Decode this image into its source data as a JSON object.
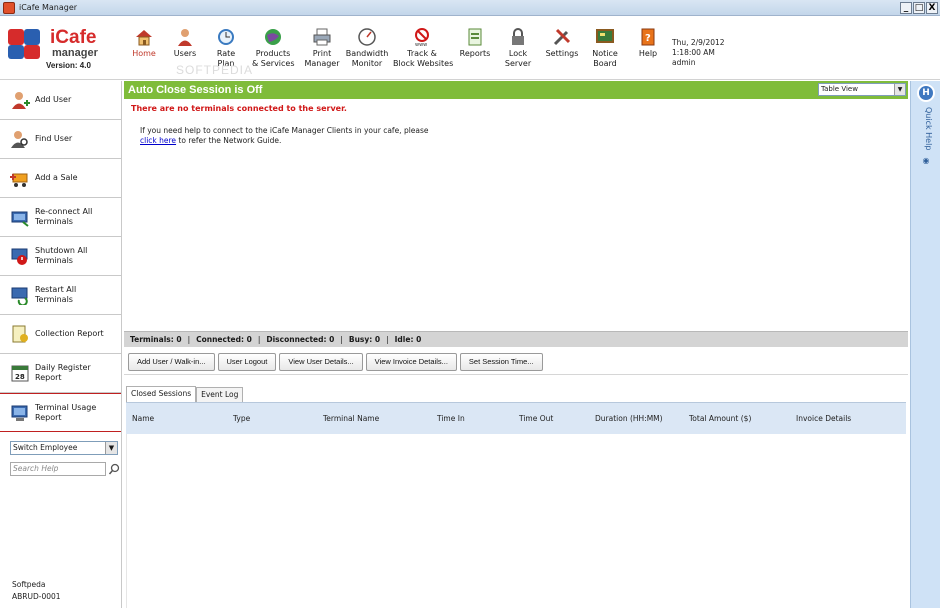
{
  "window": {
    "title": "iCafe Manager",
    "controls": [
      "_",
      "□",
      "X"
    ]
  },
  "logo": {
    "name": "iCafe",
    "sub": "manager",
    "version": "Version: 4.0"
  },
  "watermark": "SOFTPEDIA",
  "toolbar": {
    "items": [
      {
        "label": "Home",
        "icon": "home-icon",
        "active": true
      },
      {
        "label": "Users",
        "icon": "user-icon"
      },
      {
        "label": "Rate\nPlan",
        "icon": "clock-icon"
      },
      {
        "label": "Products\n& Services",
        "icon": "globe-icon"
      },
      {
        "label": "Print\nManager",
        "icon": "printer-icon"
      },
      {
        "label": "Bandwidth\nMonitor",
        "icon": "gauge-icon"
      },
      {
        "label": "Track &\nBlock Websites",
        "icon": "block-icon"
      },
      {
        "label": "Reports",
        "icon": "report-icon"
      },
      {
        "label": "Lock\nServer",
        "icon": "lock-icon"
      },
      {
        "label": "Settings",
        "icon": "tools-icon"
      },
      {
        "label": "Notice\nBoard",
        "icon": "board-icon"
      },
      {
        "label": "Help",
        "icon": "help-book-icon"
      }
    ],
    "datetime": {
      "date": "Thu, 2/9/2012",
      "time": "1:18:00 AM",
      "user": "admin"
    }
  },
  "sidebar": {
    "items": [
      {
        "label": "Add User",
        "icon": "add-user-icon"
      },
      {
        "label": "Find User",
        "icon": "find-user-icon"
      },
      {
        "label": "Add a Sale",
        "icon": "cart-icon"
      },
      {
        "label": "Re-connect All\nTerminals",
        "icon": "reconnect-icon"
      },
      {
        "label": "Shutdown All\nTerminals",
        "icon": "shutdown-icon"
      },
      {
        "label": "Restart All\nTerminals",
        "icon": "restart-icon"
      },
      {
        "label": "Collection Report",
        "icon": "collection-report-icon"
      },
      {
        "label": "Daily Register\nReport",
        "icon": "calendar-icon"
      },
      {
        "label": "Terminal Usage\nReport",
        "icon": "terminal-usage-icon"
      }
    ],
    "employee_select": "Switch Employee",
    "search_placeholder": "Search Help",
    "footer": {
      "company": "Softpeda",
      "code": "ABRUD-0001"
    }
  },
  "main": {
    "banner": "Auto Close Session is Off",
    "view_select": "Table View",
    "no_terminals": "There are no terminals connected to the server.",
    "help_line1": "If you need help to connect to the iCafe Manager Clients in your cafe, please",
    "help_link": "click here",
    "help_line2": " to refer the Network Guide.",
    "status": {
      "terminals": "Terminals: 0",
      "connected": "Connected: 0",
      "disconnected": "Disconnected: 0",
      "busy": "Busy: 0",
      "idle": "Idle: 0"
    },
    "actions": [
      "Add User / Walk-in...",
      "User Logout",
      "View User Details...",
      "View Invoice Details...",
      "Set Session Time..."
    ],
    "tabs": [
      "Closed Sessions",
      "Event Log"
    ],
    "columns": [
      "Name",
      "Type",
      "Terminal Name",
      "Time In",
      "Time Out",
      "Duration (HH:MM)",
      "Total Amount ($)",
      "Invoice Details"
    ]
  },
  "quick_help": {
    "label": "Quick Help",
    "button": "H"
  }
}
